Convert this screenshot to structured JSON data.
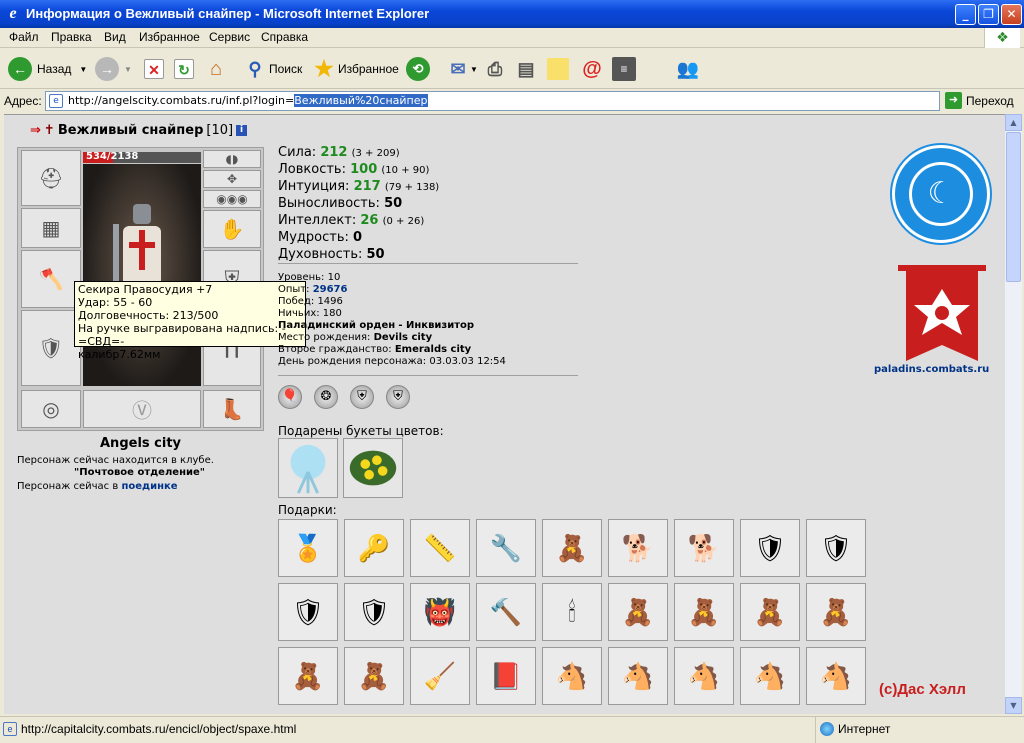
{
  "window": {
    "title": "Информация о Вежливый снайпер - Microsoft Internet Explorer",
    "minimize_glyph": "_",
    "maximize_glyph": "❐",
    "close_glyph": "✕"
  },
  "menu": [
    "Файл",
    "Правка",
    "Вид",
    "Избранное",
    "Сервис",
    "Справка"
  ],
  "toolbar": {
    "back_label": "Назад",
    "search_label": "Поиск",
    "favorites_label": "Избранное"
  },
  "address": {
    "label": "Адрес:",
    "url_prefix": "http://angelscity.combats.ru/inf.pl?login=",
    "url_selected": "Вежливый%20снайпер",
    "go_label": "Переход"
  },
  "status": {
    "url": "http://capitalcity.combats.ru/encicl/object/spaxe.html",
    "zone": "Интернет"
  },
  "character": {
    "name": "Вежливый снайпер",
    "level": "[10]",
    "hp_text": "534/2138",
    "hp_fraction": 0.25,
    "city": "Angels city",
    "location_line1": "Персонаж сейчас находится в клубе.",
    "location_line2": "\"Почтовое отделение\"",
    "location_line3_prefix": "Персонаж сейчас в",
    "location_line3_link": "поединке"
  },
  "tooltip": {
    "line1": "Секира Правосудия +7",
    "line2": "Удар: 55 - 60",
    "line3": "Долговечность: 213/500",
    "line4": "На ручке выгравирована надпись: -=СВД=-",
    "line5": "калибр7.62мм"
  },
  "stats": [
    {
      "label": "Сила:",
      "value": "212",
      "bonus": "(3 + 209)",
      "green": true
    },
    {
      "label": "Ловкость:",
      "value": "100",
      "bonus": "(10 + 90)",
      "green": true
    },
    {
      "label": "Интуиция:",
      "value": "217",
      "bonus": "(79 + 138)",
      "green": true
    },
    {
      "label": "Выносливость:",
      "value": "50",
      "bonus": "",
      "green": false
    },
    {
      "label": "Интеллект:",
      "value": "26",
      "bonus": "(0 + 26)",
      "green": true
    },
    {
      "label": "Мудрость:",
      "value": "0",
      "bonus": "",
      "green": false
    },
    {
      "label": "Духовность:",
      "value": "50",
      "bonus": "",
      "green": false
    }
  ],
  "info": {
    "level_label": "Уровень:",
    "level_value": "10",
    "exp_label": "Опыт:",
    "exp_value": "29676",
    "wins_label": "Побед:",
    "wins_value": "1496",
    "losses_label": "Ничьих:",
    "losses_value": "180",
    "clan": "Паладинский орден",
    "clan_rank": "- Инквизитор",
    "birthplace_label": "Место рождения:",
    "birthplace_value": "Devils city",
    "citizenship_label": "Второе гражданство:",
    "citizenship_value": "Emeralds city",
    "birthday_label": "День рождения персонажа:",
    "birthday_value": "03.03.03 12:54"
  },
  "flowers_title": "Подарены букеты цветов:",
  "gifts_title": "Подарки:",
  "gifts_rows": [
    [
      "🏅",
      "🔑",
      "📏",
      "🔧",
      "🧸",
      "🐕",
      "🐕",
      "🛡",
      "🛡"
    ],
    [
      "🛡",
      "🛡",
      "👹",
      "🔨",
      "🕯",
      "🧸",
      "🧸",
      "🧸",
      "🧸"
    ],
    [
      "🧸",
      "🧸",
      "🧹",
      "📕",
      "🐴",
      "🐴",
      "🐴",
      "🐴",
      "🐴"
    ]
  ],
  "banner_text": "paladins.combats.ru",
  "copyright": "(с)Дас Хэлл",
  "colors": {
    "accent_green": "#1f8b1f",
    "link_blue": "#003388",
    "brand_red": "#c81e1e",
    "emblem_blue": "#1d8de0"
  }
}
